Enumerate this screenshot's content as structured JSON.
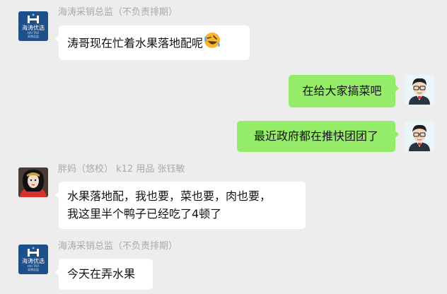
{
  "messages": [
    {
      "side": "in",
      "sender": "海涛采销总监（不负责排期）",
      "text": "涛哥现在忙着水果落地配呢",
      "emoji": "rolling-on-floor-laughing-icon",
      "avatar": "company-logo-avatar"
    },
    {
      "side": "out",
      "text": "在给大家搞菜吧",
      "avatar": "user-cartoon-avatar"
    },
    {
      "side": "out",
      "text": "最近政府都在推快团团了",
      "avatar": "user-cartoon-avatar"
    },
    {
      "side": "in",
      "sender": "胖妈（悠校） k12 用品 张钰敏",
      "text_lines": [
        "水果落地配，我也要，菜也要，肉也要，",
        "我这里半个鸭子已经吃了4顿了"
      ],
      "avatar": "woman-photo-avatar"
    },
    {
      "side": "in",
      "sender": "海涛采销总监（不负责排期）",
      "text": "今天在弄水果",
      "avatar": "company-logo-avatar"
    }
  ],
  "logo": {
    "brand": "海涛优选",
    "small": "HAI TAO",
    "tag": "采销总监"
  },
  "colors": {
    "background": "#ededed",
    "incoming_bubble": "#ffffff",
    "outgoing_bubble": "#95ec69",
    "sender_name": "#a9a9a9",
    "logo_bg": "#1d4f8a"
  }
}
